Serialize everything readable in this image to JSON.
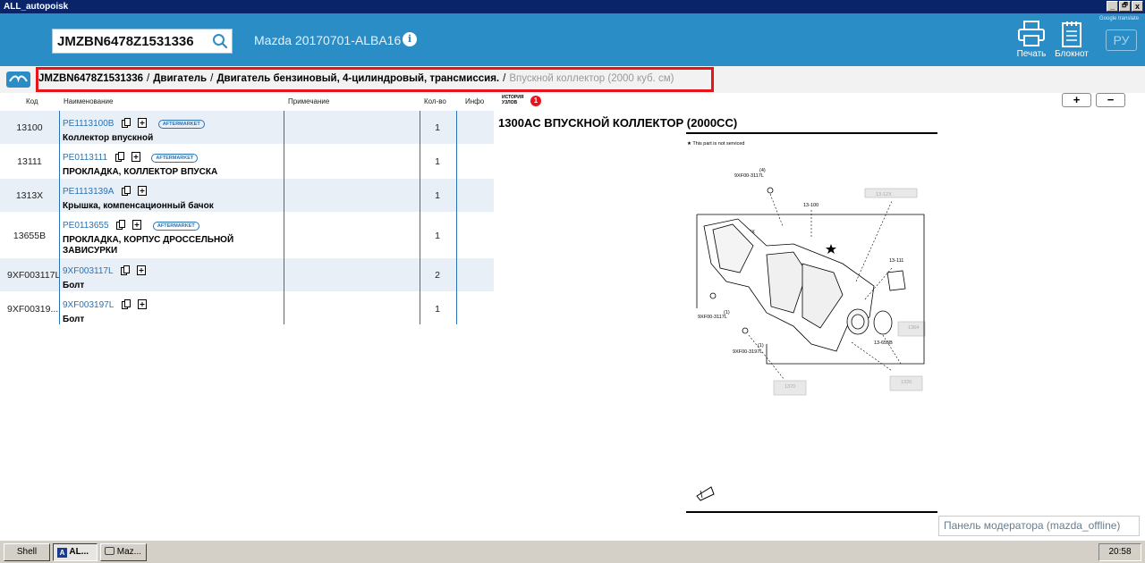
{
  "window": {
    "title": "ALL_autopoisk",
    "minimize": "_",
    "restore": "🗗",
    "close": "x"
  },
  "header": {
    "vin_value": "JMZBN6478Z1531336",
    "model": "Mazda 20170701-ALBA16",
    "print_label": "Печать",
    "notepad_label": "Блокнот",
    "google_translate": "Google translate",
    "lang_button": "РУ"
  },
  "breadcrumb": {
    "items": [
      "JMZBN6478Z1531336",
      "Двигатель",
      "Двигатель бензиновый, 4-цилиндровый, трансмиссия.",
      "Впускной коллектор (2000 куб. см)"
    ],
    "separator": "/"
  },
  "table": {
    "headers": {
      "code": "Код",
      "name": "Наименование",
      "note": "Примечание",
      "qty": "Кол-во",
      "info": "Инфо"
    },
    "history_label_1": "ИСТОРИЯ",
    "history_label_2": "УЗЛОВ",
    "history_count": "1",
    "aftermarket_label": "AFTERMARKET",
    "rows": [
      {
        "code": "13100",
        "number": "PE1113100B",
        "title": "Коллектор впускной",
        "qty": "1",
        "aftermarket": true
      },
      {
        "code": "13111",
        "number": "PE0113111",
        "title": "ПРОКЛАДКА, КОЛЛЕКТОР ВПУСКА",
        "qty": "1",
        "aftermarket": true
      },
      {
        "code": "1313X",
        "number": "PE1113139A",
        "title": "Крышка, компенсационный бачок",
        "qty": "1",
        "aftermarket": false
      },
      {
        "code": "13655B",
        "number": "PE0113655",
        "title": "ПРОКЛАДКА, КОРПУС ДРОССЕЛЬНОЙ ЗАВИСУРКИ",
        "qty": "1",
        "aftermarket": true
      },
      {
        "code": "9XF003117L",
        "number": "9XF003117L",
        "title": "Болт",
        "qty": "2",
        "aftermarket": false
      },
      {
        "code": "9XF00319...",
        "number": "9XF003197L",
        "title": "Болт",
        "qty": "1",
        "aftermarket": false
      }
    ]
  },
  "zoom": {
    "plus": "+",
    "minus": "−"
  },
  "diagram": {
    "title": "1300AC ВПУСКНОЙ КОЛЛЕКТОР (2000CC)",
    "note": "★ This part is not serviced",
    "labels": [
      "(4)",
      "9XF00-3117L",
      "13-100",
      "13-13X",
      "13-111",
      "(1)",
      "9XF00-3117L",
      "(1)",
      "9XF00-3197L",
      "13-655B",
      "13-12X",
      "1364",
      "1370",
      "1320"
    ]
  },
  "moderator_panel": "Панель модератора (mazda_offline)",
  "taskbar": {
    "shell": "Shell",
    "app1": "AL...",
    "app2": "Maz...",
    "clock": "20:58"
  }
}
